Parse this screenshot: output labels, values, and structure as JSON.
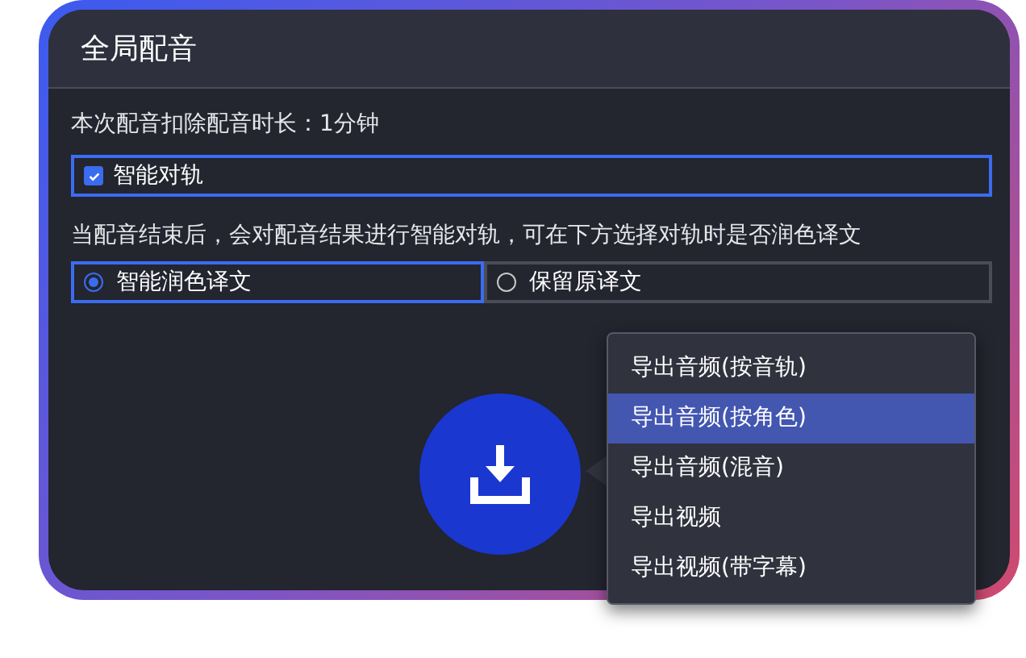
{
  "dialog": {
    "title": "全局配音"
  },
  "deduction_note": "本次配音扣除配音时长：1分钟",
  "smart_align": {
    "label": "智能对轨",
    "checked": true
  },
  "description": "当配音结束后，会对配音结果进行智能对轨，可在下方选择对轨时是否润色译文",
  "options": [
    {
      "label": "智能润色译文",
      "selected": true
    },
    {
      "label": "保留原译文",
      "selected": false
    }
  ],
  "export_menu": [
    {
      "label": "导出音频(按音轨)",
      "selected": false
    },
    {
      "label": "导出音频(按角色)",
      "selected": true
    },
    {
      "label": "导出音频(混音)",
      "selected": false
    },
    {
      "label": "导出视频",
      "selected": false
    },
    {
      "label": "导出视频(带字幕)",
      "selected": false
    }
  ]
}
